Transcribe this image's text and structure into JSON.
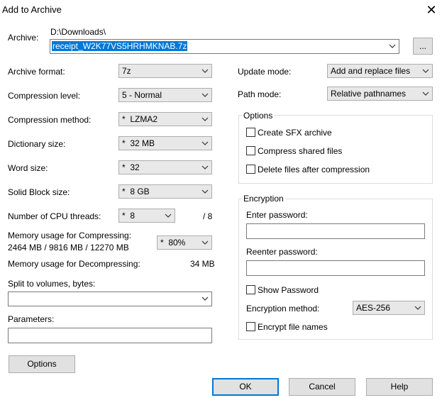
{
  "window": {
    "title": "Add to Archive",
    "close_icon": "close-icon"
  },
  "archive": {
    "label": "Archive:",
    "folder": "D:\\Downloads\\",
    "filename": "receipt_W2K77VS5HRHMKNAB.7z",
    "browse_label": "..."
  },
  "left": {
    "format": {
      "label": "Archive format:",
      "value": "7z"
    },
    "level": {
      "label": "Compression level:",
      "value": "5 - Normal"
    },
    "method": {
      "label": "Compression method:",
      "value": "*  LZMA2"
    },
    "dictionary": {
      "label": "Dictionary size:",
      "value": "*  32 MB"
    },
    "word": {
      "label": "Word size:",
      "value": "*  32"
    },
    "solid": {
      "label": "Solid Block size:",
      "value": "*  8 GB"
    },
    "threads": {
      "label": "Number of CPU threads:",
      "value": "*  8",
      "max": "/ 8"
    },
    "mem_compress": {
      "label": "Memory usage for Compressing:",
      "detail": "2464 MB / 9816 MB / 12270 MB",
      "value": "*  80%"
    },
    "mem_decompress": {
      "label": "Memory usage for Decompressing:",
      "value": "34 MB"
    },
    "split": {
      "label": "Split to volumes, bytes:",
      "value": ""
    },
    "parameters": {
      "label": "Parameters:",
      "value": ""
    },
    "options_button": "Options"
  },
  "right": {
    "update_mode": {
      "label": "Update mode:",
      "value": "Add and replace files"
    },
    "path_mode": {
      "label": "Path mode:",
      "value": "Relative pathnames"
    },
    "options_group": {
      "title": "Options",
      "create_sfx": "Create SFX archive",
      "compress_shared": "Compress shared files",
      "delete_after": "Delete files after compression"
    },
    "encryption": {
      "title": "Encryption",
      "enter_password": "Enter password:",
      "reenter_password": "Reenter password:",
      "show_password": "Show Password",
      "method_label": "Encryption method:",
      "method_value": "AES-256",
      "encrypt_names": "Encrypt file names"
    }
  },
  "buttons": {
    "ok": "OK",
    "cancel": "Cancel",
    "help": "Help"
  },
  "colors": {
    "accent": "#0078d7",
    "button_face": "#e1e1e1",
    "combo_face": "#e8e8e8"
  }
}
